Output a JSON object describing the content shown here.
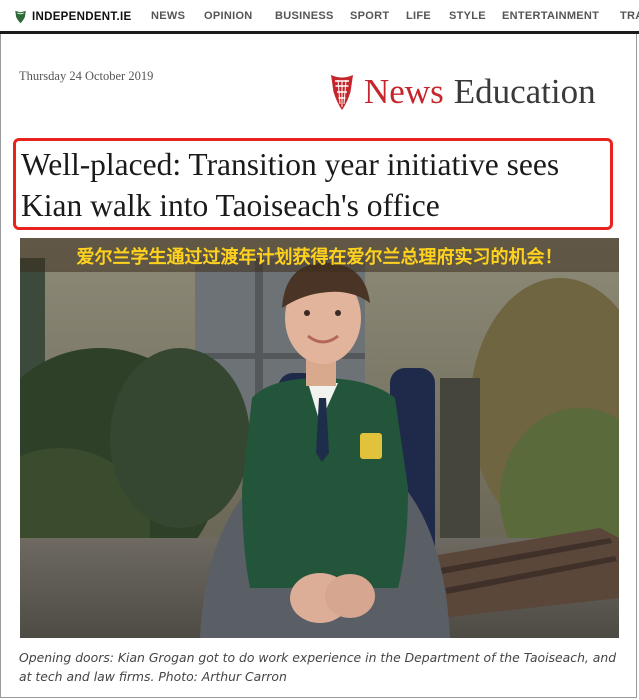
{
  "site": {
    "brand": "INDEPENDENT.IE"
  },
  "nav": {
    "items": [
      {
        "label": "NEWS"
      },
      {
        "label": "OPINION"
      },
      {
        "label": "BUSINESS"
      },
      {
        "label": "SPORT"
      },
      {
        "label": "LIFE"
      },
      {
        "label": "STYLE"
      },
      {
        "label": "ENTERTAINMENT"
      },
      {
        "label": "TRA"
      }
    ]
  },
  "article": {
    "date": "Thursday 24 October 2019",
    "section": {
      "news": "News",
      "name": "Education"
    },
    "headline": "Well-placed: Transition year initiative sees Kian walk into Taoiseach's office",
    "overlay_text": "爱尔兰学生通过过渡年计划获得在爱尔兰总理府实习的机会！",
    "caption": "Opening doors: Kian Grogan got to do work experience in the Department of the Taoiseach, and at tech and law firms. Photo: Arthur Carron"
  },
  "colors": {
    "brand_red": "#c5262b",
    "highlight_border": "#e8231d",
    "overlay_text": "#ffd21e",
    "nav_text": "#555555"
  },
  "icons": {
    "brand": "harp-icon",
    "section": "harp-icon"
  }
}
